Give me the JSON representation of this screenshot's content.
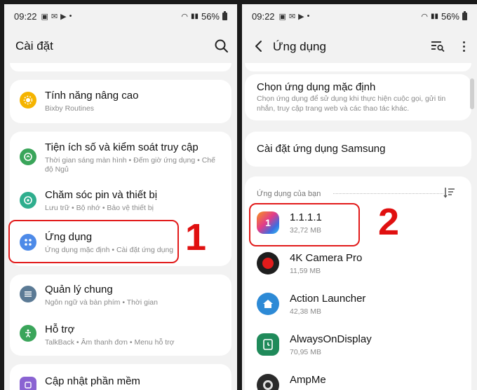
{
  "status_left": {
    "time": "09:22",
    "battery": "56%"
  },
  "status_right": {
    "time": "09:22",
    "battery": "56%"
  },
  "left": {
    "title": "Cài đặt",
    "items": [
      {
        "title": "Tính năng nâng cao",
        "sub": "Bixby Routines"
      },
      {
        "title": "Tiện ích số và kiểm soát truy cập",
        "sub": "Thời gian sáng màn hình  •  Đếm giờ ứng dụng  •  Chế độ Ngủ"
      },
      {
        "title": "Chăm sóc pin và thiết bị",
        "sub": "Lưu trữ  •  Bộ nhớ  •  Bảo vệ thiết bị"
      },
      {
        "title": "Ứng dụng",
        "sub": "Ứng dụng mặc định  •  Cài đặt ứng dụng"
      },
      {
        "title": "Quản lý chung",
        "sub": "Ngôn ngữ và bàn phím  •  Thời gian"
      },
      {
        "title": "Hỗ trợ",
        "sub": "TalkBack  •  Âm thanh đơn  •  Menu hỗ trợ"
      },
      {
        "title": "Cập nhật phần mềm",
        "sub": ""
      }
    ],
    "annotation": "1"
  },
  "right": {
    "title": "Ứng dụng",
    "default_apps": {
      "title": "Chọn ứng dụng mặc định",
      "sub": "Chọn ứng dụng để sử dụng khi thực hiện cuộc gọi, gửi tin nhắn, truy cập trang web và các thao tác khác."
    },
    "samsung": {
      "title": "Cài đặt ứng dụng Samsung"
    },
    "section_label": "Ứng dụng của bạn",
    "apps": [
      {
        "name": "1.1.1.1",
        "size": "32,72 MB",
        "icon": "cloudflare-1111-icon"
      },
      {
        "name": "4K Camera Pro",
        "size": "11,59 MB",
        "icon": "camera-record-icon"
      },
      {
        "name": "Action Launcher",
        "size": "42,38 MB",
        "icon": "home-launcher-icon"
      },
      {
        "name": "AlwaysOnDisplay",
        "size": "70,95 MB",
        "icon": "clock-display-icon"
      },
      {
        "name": "AmpMe",
        "size": "",
        "icon": "speaker-icon"
      }
    ],
    "annotation": "2"
  },
  "colors": {
    "highlight": "#e21b1b",
    "annotation": "#e01010"
  }
}
